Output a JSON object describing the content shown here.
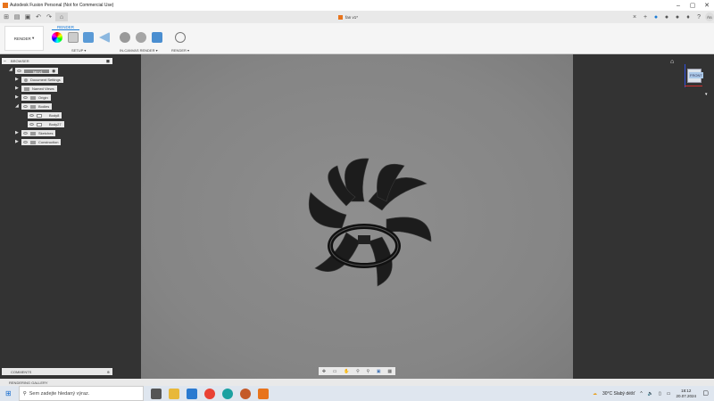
{
  "window": {
    "title": "Autodesk Fusion Personal (Not for Commercial Use)",
    "doc_tab": "fan v1*"
  },
  "ribbon": {
    "workspace": "RENDER",
    "tab": "RENDER",
    "groups": [
      "SETUP ▾",
      "IN-CANVAS RENDER ▾",
      "RENDER ▾"
    ]
  },
  "browser": {
    "title": "BROWSER",
    "root": "fan v1",
    "items": [
      {
        "label": "Document Settings",
        "level": 1
      },
      {
        "label": "Named Views",
        "level": 1
      },
      {
        "label": "Origin",
        "level": 1
      },
      {
        "label": "Bodies",
        "level": 1,
        "expanded": true
      },
      {
        "label": "Body8",
        "level": 2
      },
      {
        "label": "Body27",
        "level": 2
      },
      {
        "label": "Sketches",
        "level": 1
      },
      {
        "label": "Construction",
        "level": 1
      }
    ]
  },
  "viewcube": {
    "face": "FRONT"
  },
  "comments": {
    "label": "COMMENTS"
  },
  "gallery": {
    "label": "RENDERING GALLERY"
  },
  "taskbar": {
    "search_placeholder": "Sem zadejte hledaný výraz.",
    "weather": "30°C  Slabý déšť",
    "time": "18:12",
    "date": "20.07.2024"
  }
}
